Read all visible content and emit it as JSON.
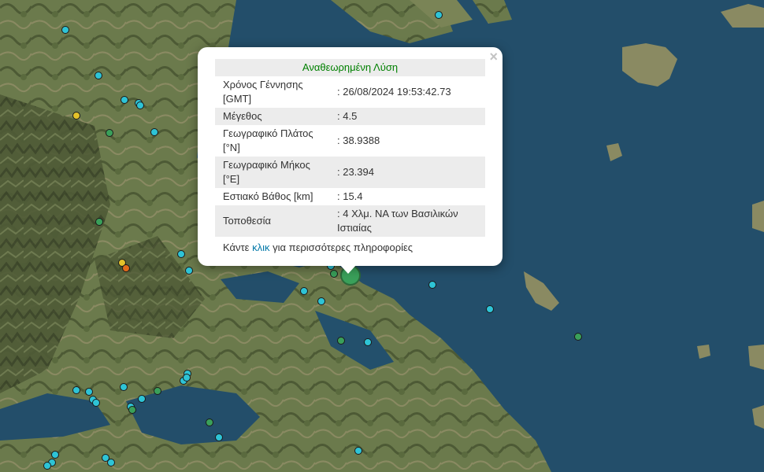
{
  "popup": {
    "title": "Αναθεωρημένη Λύση",
    "close_symbol": "×",
    "rows": [
      {
        "label": "Χρόνος Γέννησης [GMT]",
        "value": ": 26/08/2024 19:53:42.73"
      },
      {
        "label": "Μέγεθος",
        "value": ": 4.5"
      },
      {
        "label": "Γεωγραφικό Πλάτος [°N]",
        "value": ": 38.9388"
      },
      {
        "label": "Γεωγραφικό Μήκος [°E]",
        "value": ": 23.394"
      },
      {
        "label": "Εστιακό Βάθος [km]",
        "value": ": 15.4"
      },
      {
        "label": "Τοποθεσία",
        "value": ": 4 Χλμ. ΝΑ των Βασιλικών Ιστιαίας"
      }
    ],
    "footer_prefix": "Κάντε ",
    "footer_link": "κλικ",
    "footer_suffix": " για περισσότερες πληροφορίες"
  },
  "colors": {
    "cyan": "#2ec4d6",
    "green": "#3aa05a",
    "yellow": "#e4c22a",
    "orange": "#e06a1a",
    "selected": "#3aa05a",
    "link": "#0078a8",
    "title_green": "#008000"
  },
  "map": {
    "type": "satellite",
    "markers": [
      {
        "color": "cyan",
        "kind": "earthquake"
      },
      {
        "color": "cyan",
        "kind": "earthquake"
      },
      {
        "color": "cyan",
        "kind": "earthquake"
      },
      {
        "color": "cyan",
        "kind": "earthquake"
      },
      {
        "color": "cyan",
        "kind": "earthquake"
      },
      {
        "color": "yellow",
        "kind": "earthquake"
      },
      {
        "color": "green",
        "kind": "earthquake"
      },
      {
        "color": "cyan",
        "kind": "earthquake"
      },
      {
        "color": "green",
        "kind": "earthquake"
      },
      {
        "color": "cyan",
        "kind": "earthquake"
      },
      {
        "color": "yellow",
        "kind": "earthquake"
      },
      {
        "color": "orange",
        "kind": "earthquake"
      },
      {
        "color": "cyan",
        "kind": "earthquake"
      },
      {
        "color": "cyan",
        "kind": "earthquake"
      },
      {
        "color": "cyan",
        "kind": "earthquake"
      },
      {
        "color": "green",
        "kind": "earthquake"
      },
      {
        "color": "cyan",
        "kind": "earthquake"
      },
      {
        "color": "cyan",
        "kind": "earthquake"
      },
      {
        "color": "cyan",
        "kind": "earthquake"
      },
      {
        "color": "cyan",
        "kind": "earthquake"
      },
      {
        "color": "green",
        "kind": "earthquake"
      },
      {
        "color": "cyan",
        "kind": "earthquake"
      },
      {
        "color": "green",
        "kind": "earthquake"
      },
      {
        "color": "cyan",
        "kind": "earthquake"
      },
      {
        "color": "cyan",
        "kind": "earthquake"
      },
      {
        "color": "cyan",
        "kind": "earthquake"
      },
      {
        "color": "cyan",
        "kind": "earthquake"
      },
      {
        "color": "cyan",
        "kind": "earthquake"
      },
      {
        "color": "cyan",
        "kind": "earthquake"
      },
      {
        "color": "cyan",
        "kind": "earthquake"
      },
      {
        "color": "green",
        "kind": "earthquake"
      },
      {
        "color": "cyan",
        "kind": "earthquake"
      },
      {
        "color": "cyan",
        "kind": "earthquake"
      },
      {
        "color": "green",
        "kind": "earthquake"
      },
      {
        "color": "green",
        "kind": "earthquake"
      },
      {
        "color": "cyan",
        "kind": "earthquake"
      },
      {
        "color": "cyan",
        "kind": "earthquake"
      },
      {
        "color": "cyan",
        "kind": "earthquake"
      },
      {
        "color": "cyan",
        "kind": "earthquake"
      },
      {
        "color": "cyan",
        "kind": "earthquake"
      },
      {
        "color": "cyan",
        "kind": "earthquake"
      },
      {
        "color": "cyan",
        "kind": "earthquake"
      },
      {
        "color": "cyan",
        "kind": "earthquake"
      },
      {
        "color": "cyan",
        "kind": "earthquake"
      },
      {
        "color": "selected",
        "kind": "selected-earthquake"
      }
    ]
  }
}
